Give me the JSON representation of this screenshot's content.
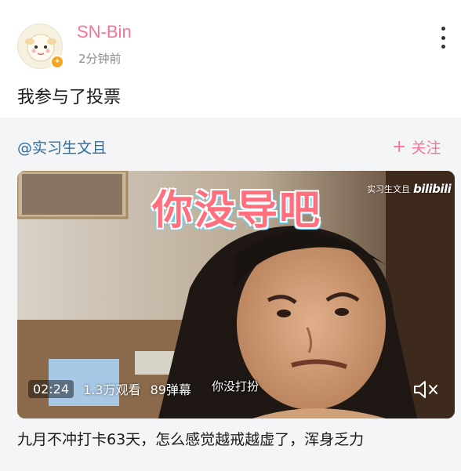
{
  "post": {
    "username": "SN-Bin",
    "time": "2分钟前",
    "text": "我参与了投票"
  },
  "repost": {
    "author": "@实习生文且",
    "follow_plus": "+",
    "follow_label": "关注",
    "video": {
      "overlay_caption": "你没导吧",
      "watermark_author": "实习生文且",
      "watermark_brand": "bilibili",
      "subtitle": "你没打扮",
      "duration": "02:24",
      "views": "1.3万观看",
      "danmaku": "89弹幕"
    },
    "title": "九月不冲打卡63天，怎么感觉越戒越虚了，浑身乏力"
  },
  "colors": {
    "username": "#fb7299",
    "author_link": "#2e6f9e",
    "follow": "#fb7299",
    "card_bg": "#f4f5f7"
  },
  "icons": {
    "more": "vertical-dots-icon",
    "badge": "vip-badge-icon",
    "mute": "speaker-mute-icon"
  }
}
